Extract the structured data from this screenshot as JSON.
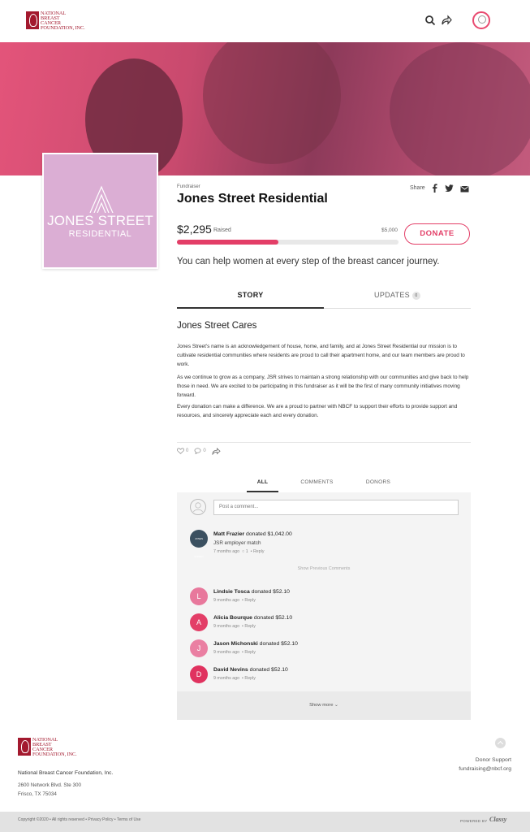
{
  "org": {
    "logo_lines": [
      "National",
      "Breast",
      "Cancer",
      "Foundation, Inc."
    ],
    "name": "National Breast Cancer Foundation, Inc.",
    "address_line1": "2600 Network Blvd. Ste 300",
    "address_line2": "Frisco, TX 75034"
  },
  "header": {
    "icons": [
      "search-icon",
      "share-icon",
      "user-avatar-icon"
    ]
  },
  "tile": {
    "line1": "JONES STREET",
    "line2": "RESIDENTIAL"
  },
  "fundraiser": {
    "label": "Fundraiser",
    "title": "Jones Street Residential",
    "share_label": "Share",
    "raised": "$2,295",
    "raised_label": "Raised",
    "goal": "$5,000",
    "progress_fraction": 0.459,
    "donate_label": "DONATE",
    "tagline": "You can help women at every step of the breast cancer journey."
  },
  "tabs": {
    "story": "STORY",
    "updates": "UPDATES",
    "updates_count": "0"
  },
  "story": {
    "heading": "Jones Street Cares",
    "p1": "Jones Street's name is an acknowledgement of house, home, and family, and at Jones Street Residential our mission is to cultivate residential communities where residents are proud to call their apartment home, and our team members are proud to work.",
    "p2": "As we continue to grow as a company, JSR strives to maintain a strong relationship with our communities and give back to help those in need. We are excited to be participating in this fundraiser as it will be the first of many community initiatives moving forward.",
    "p3": "Every donation can make a difference. We are a proud to partner with NBCF to support their efforts to provide support and resources, and sincerely appreciate each and every donation."
  },
  "social": {
    "likes": "0",
    "comments": "0"
  },
  "activity": {
    "tabs": [
      "ALL",
      "COMMENTS",
      "DONORS"
    ],
    "comment_placeholder": "Post a comment...",
    "featured": {
      "name": "Matt Frazier",
      "action": "donated $1,042.00",
      "note": "JSR employer match",
      "time": "7 months ago",
      "comment_count": "1",
      "reply": "Reply"
    },
    "show_previous": "Show Previous Comments",
    "donors": [
      {
        "initial": "L",
        "name": "Lindsie Tosca",
        "action": "donated $52.10",
        "time": "9 months ago",
        "reply": "Reply",
        "color": "#e8789c"
      },
      {
        "initial": "A",
        "name": "Alicia Bourque",
        "action": "donated $52.10",
        "time": "9 months ago",
        "reply": "Reply",
        "color": "#e33e67"
      },
      {
        "initial": "J",
        "name": "Jason Michonski",
        "action": "donated $52.10",
        "time": "9 months ago",
        "reply": "Reply",
        "color": "#ea7fa2"
      },
      {
        "initial": "D",
        "name": "David Nevins",
        "action": "donated $52.10",
        "time": "9 months ago",
        "reply": "Reply",
        "color": "#e0325f"
      }
    ],
    "show_more": "Show more"
  },
  "footer": {
    "support_title": "Donor Support",
    "support_email": "fundraising@nbcf.org",
    "copyright": "Copyright ©2020 • All rights reserved • Privacy Policy • Terms of Use",
    "powered_by": "POWERED BY",
    "powered_brand": "Classy"
  },
  "colors": {
    "accent": "#e33e67",
    "brand": "#a3192e",
    "tile": "#dbaed4"
  }
}
